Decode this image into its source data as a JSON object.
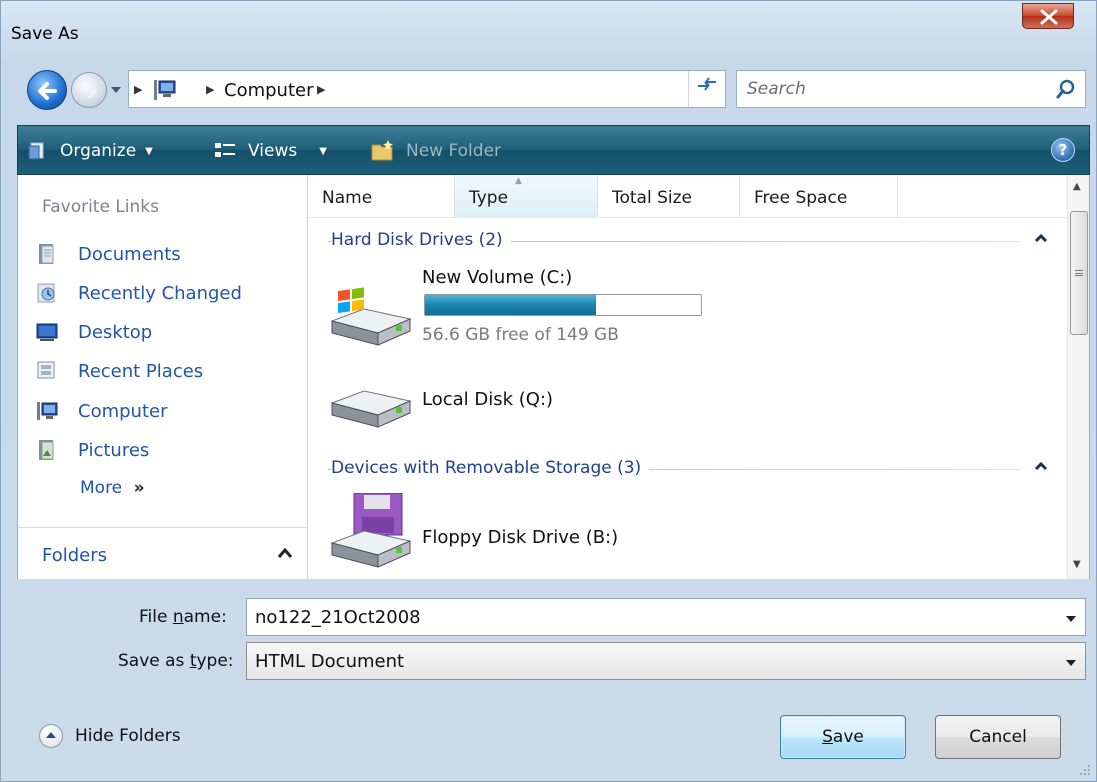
{
  "window": {
    "title": "Save As",
    "close_symbol": "X"
  },
  "address": {
    "location_icon": "computer-icon",
    "crumb": "Computer",
    "search_placeholder": "Search"
  },
  "toolbar": {
    "organize": "Organize",
    "views": "Views",
    "new_folder": "New Folder",
    "help": "?"
  },
  "sidebar": {
    "title": "Favorite Links",
    "items": [
      {
        "label": "Documents",
        "icon": "documents-icon"
      },
      {
        "label": "Recently Changed",
        "icon": "recently-changed-icon"
      },
      {
        "label": "Desktop",
        "icon": "desktop-icon"
      },
      {
        "label": "Recent Places",
        "icon": "recent-places-icon"
      },
      {
        "label": "Computer",
        "icon": "computer-icon"
      },
      {
        "label": "Pictures",
        "icon": "pictures-icon"
      }
    ],
    "more": "More",
    "more_arrow": "»",
    "folders": "Folders"
  },
  "columns": [
    "Name",
    "Type",
    "Total Size",
    "Free Space"
  ],
  "sorted_column": "Type",
  "groups": [
    {
      "label": "Hard Disk Drives (2)",
      "drives": [
        {
          "name": "New Volume (C:)",
          "free_text": "56.6 GB free of 149 GB",
          "used_fraction": 0.62,
          "icon": "windows-drive-icon"
        },
        {
          "name": "Local Disk (Q:)",
          "icon": "hard-drive-icon"
        }
      ]
    },
    {
      "label": "Devices with Removable Storage (3)",
      "drives": [
        {
          "name": "Floppy Disk Drive (B:)",
          "icon": "floppy-drive-icon"
        }
      ]
    }
  ],
  "form": {
    "file_name_label_pre": "File ",
    "file_name_label_u": "n",
    "file_name_label_post": "ame:",
    "file_name_value": "no122_21Oct2008",
    "type_label_pre": "Save as ",
    "type_label_u": "t",
    "type_label_post": "ype:",
    "type_value": "HTML Document"
  },
  "footer": {
    "hide_folders": "Hide Folders",
    "save_u": "S",
    "save_rest": "ave",
    "cancel": "Cancel"
  },
  "colors": {
    "link": "#1f56a8",
    "toolbar": "#1f5e78",
    "usage_fill": "#1c84ae"
  }
}
